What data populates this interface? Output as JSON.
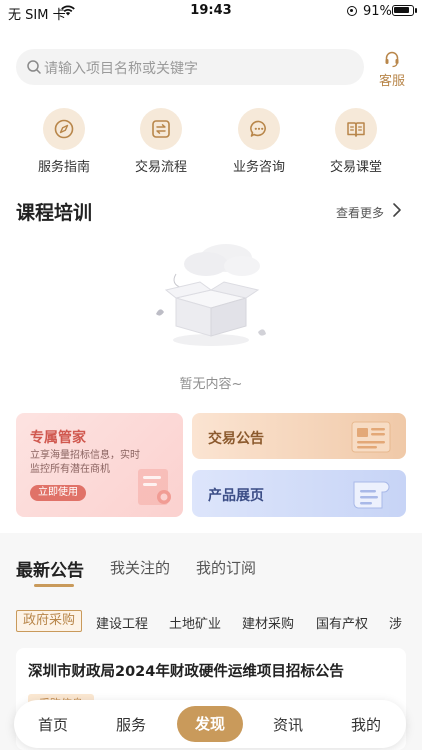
{
  "status_bar": {
    "carrier": "无 SIM 卡",
    "time": "19:43",
    "battery_text": "91%",
    "battery_level": 0.91,
    "icons": [
      "wifi-icon",
      "orientation-lock-icon",
      "battery-icon"
    ]
  },
  "search": {
    "placeholder": "请输入项目名称或关键字",
    "icon": "search-icon"
  },
  "service": {
    "label": "客服",
    "icon": "headset-icon"
  },
  "quick_entries": [
    {
      "label": "服务指南",
      "icon": "compass-icon"
    },
    {
      "label": "交易流程",
      "icon": "exchange-icon"
    },
    {
      "label": "业务咨询",
      "icon": "chat-icon"
    },
    {
      "label": "交易课堂",
      "icon": "book-icon"
    }
  ],
  "course": {
    "title": "课程培训",
    "more": "查看更多",
    "empty_text": "暂无内容~"
  },
  "cards": {
    "exclusive": {
      "title": "专属管家",
      "desc": "立享海量招标信息，实时监控所有潜在商机",
      "button": "立即使用"
    },
    "trade_notice": {
      "title": "交易公告"
    },
    "product_show": {
      "title": "产品展页"
    }
  },
  "announcements": {
    "tabs": [
      "最新公告",
      "我关注的",
      "我的订阅"
    ],
    "active_tab": "最新公告",
    "filters": [
      "政府采购",
      "建设工程",
      "土地矿业",
      "建材采购",
      "国有产权",
      "涉"
    ],
    "active_filter": "政府采购",
    "items": [
      {
        "title": "深圳市财政局2024年财政硬件运维项目招标公告",
        "tag": "采购信息"
      }
    ]
  },
  "bottom_nav": {
    "items": [
      "首页",
      "服务",
      "发现",
      "资讯",
      "我的"
    ],
    "active": "发现"
  },
  "colors": {
    "accent": "#c99a5b",
    "accent_text": "#b8864a",
    "icon_bg": "#f6e9d9"
  }
}
